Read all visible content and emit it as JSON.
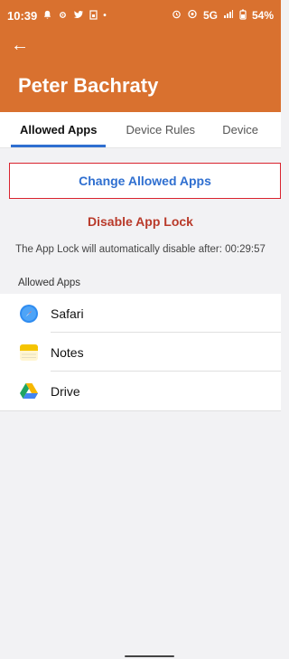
{
  "status_bar": {
    "time": "10:39",
    "network": "5G",
    "battery": "54%"
  },
  "header": {
    "title": "Peter Bachraty",
    "back_icon": "arrow-left-icon",
    "color": "#d9712f"
  },
  "tabs": [
    {
      "label": "Allowed Apps",
      "active": true
    },
    {
      "label": "Device Rules",
      "active": false
    },
    {
      "label": "Device",
      "active": false
    }
  ],
  "actions": {
    "change_allowed": "Change Allowed Apps",
    "disable_lock": "Disable App Lock"
  },
  "note": "The App Lock will automatically disable after: 00:29:57",
  "allowed_section": {
    "label": "Allowed Apps",
    "items": [
      {
        "label": "Safari",
        "icon": "safari-icon"
      },
      {
        "label": "Notes",
        "icon": "notes-icon"
      },
      {
        "label": "Drive",
        "icon": "drive-icon"
      }
    ]
  },
  "colors": {
    "accent": "#2f6fd0",
    "danger": "#b93a2a",
    "highlight_border": "#d9232e"
  }
}
